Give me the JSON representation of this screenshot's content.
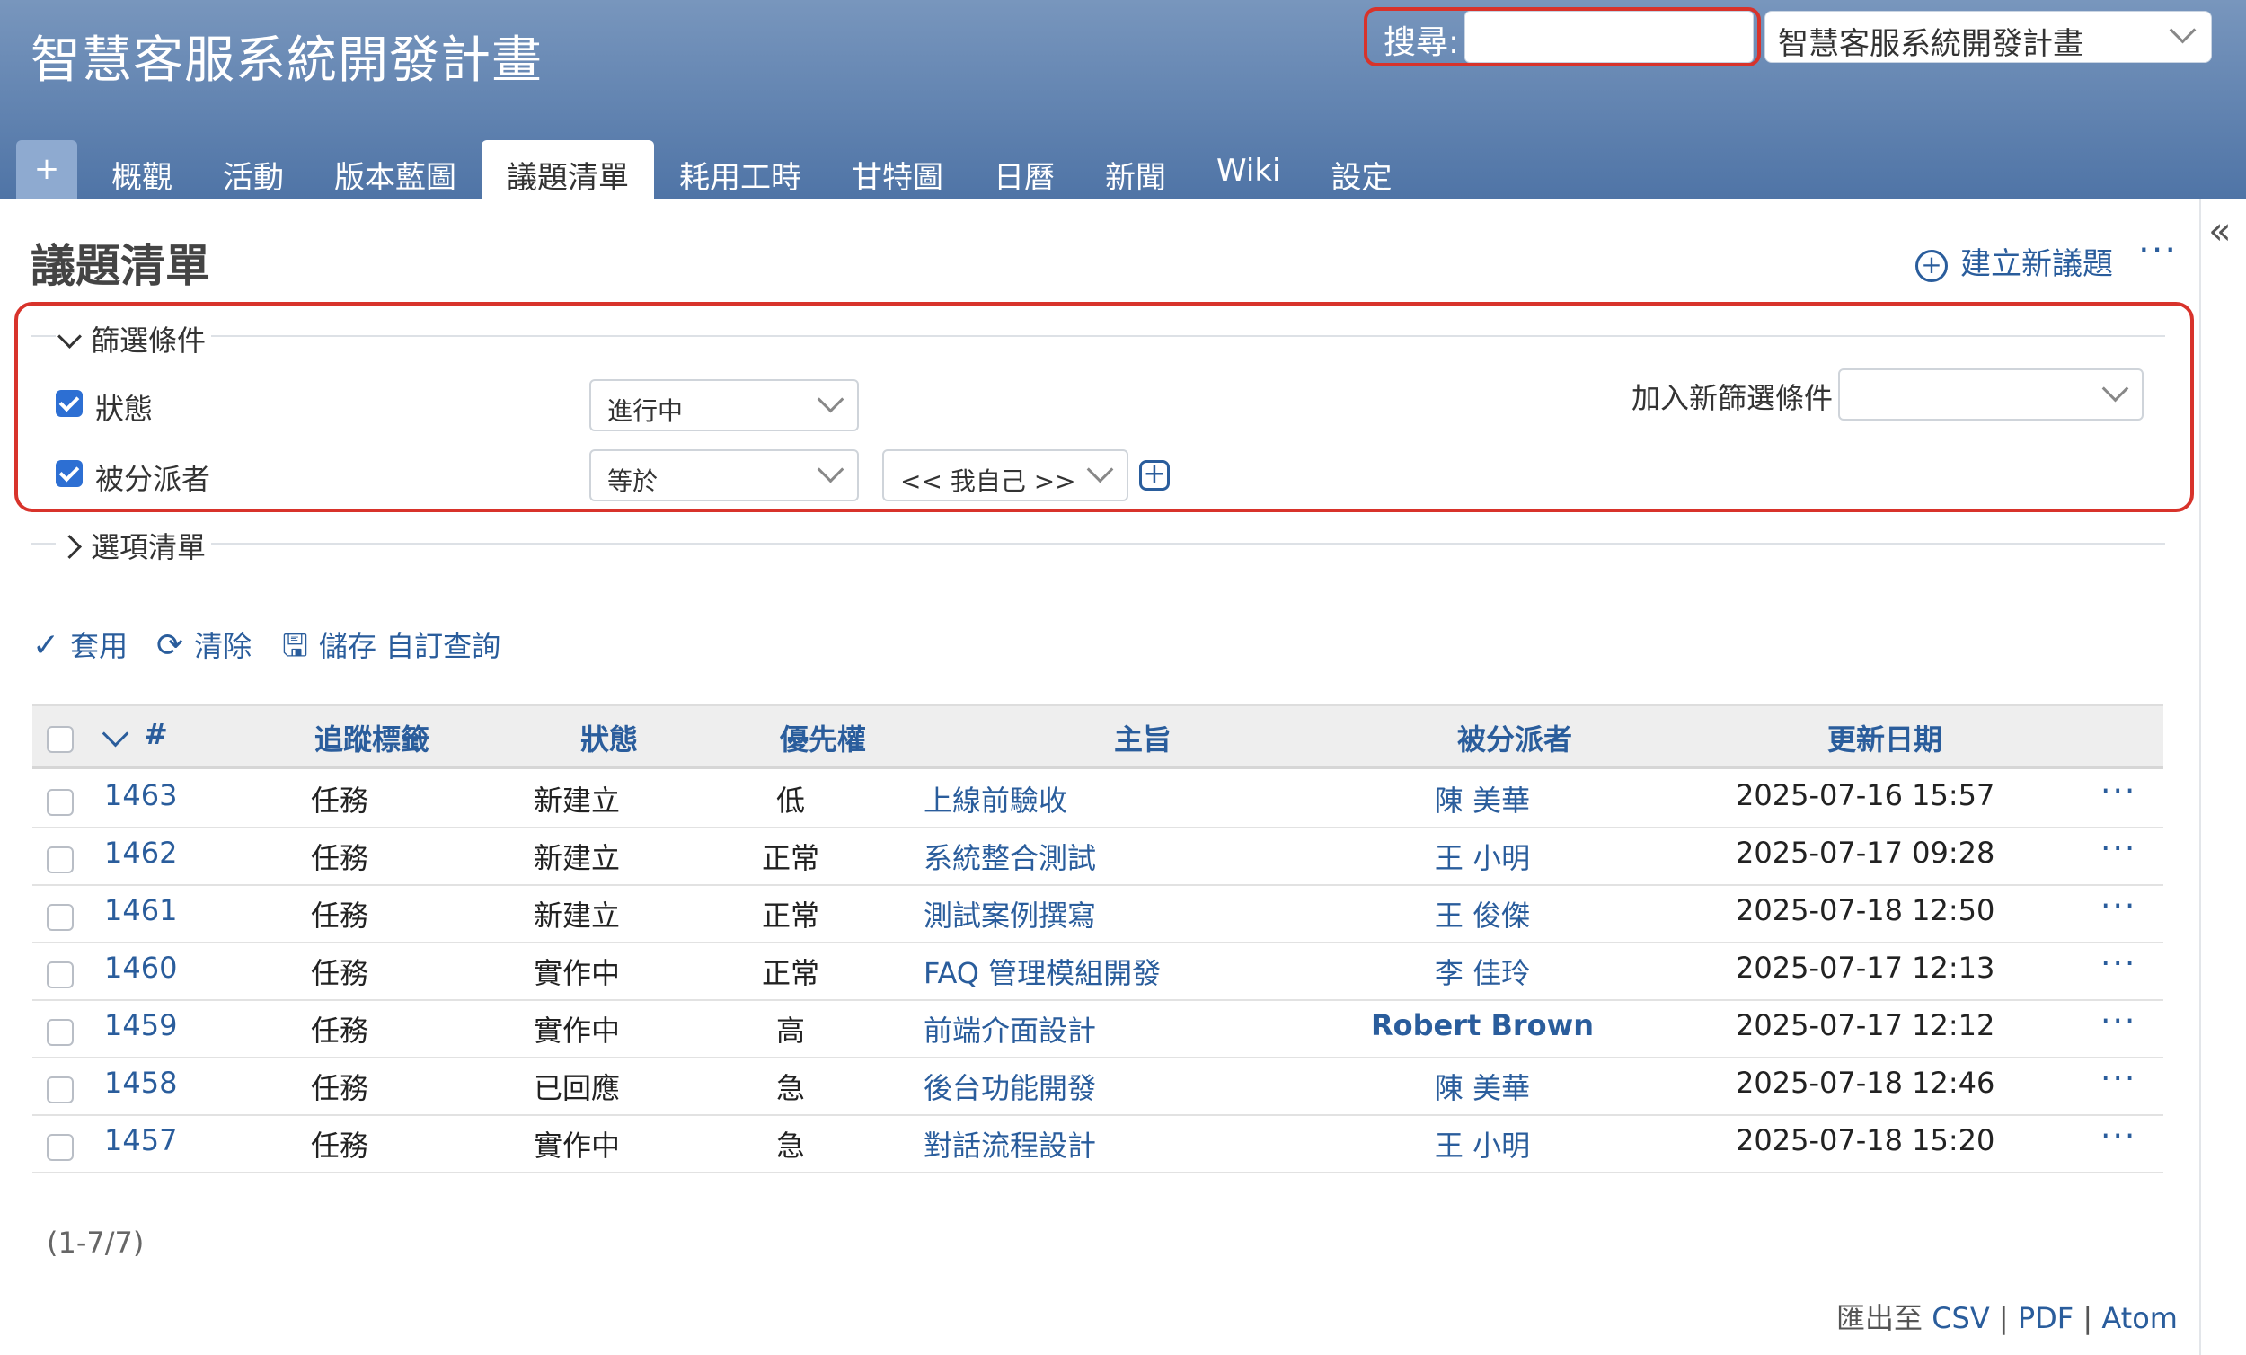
{
  "header": {
    "project_title": "智慧客服系統開發計畫",
    "search_label": "搜尋:",
    "search_value": "",
    "project_select": "智慧客服系統開發計畫"
  },
  "tabs": [
    {
      "label": "+"
    },
    {
      "label": "概觀"
    },
    {
      "label": "活動"
    },
    {
      "label": "版本藍圖"
    },
    {
      "label": "議題清單",
      "active": true
    },
    {
      "label": "耗用工時"
    },
    {
      "label": "甘特圖"
    },
    {
      "label": "日曆"
    },
    {
      "label": "新聞"
    },
    {
      "label": "Wiki"
    },
    {
      "label": "設定"
    }
  ],
  "page": {
    "title": "議題清單",
    "new_issue": "建立新議題",
    "more": "···"
  },
  "filters": {
    "legend": "篩選條件",
    "status_label": "狀態",
    "status_value": "進行中",
    "assignee_label": "被分派者",
    "assignee_op": "等於",
    "assignee_value": "<< 我自己 >>",
    "add_filter_label": "加入新篩選條件",
    "add_filter_value": ""
  },
  "options": {
    "legend": "選項清單"
  },
  "actions": {
    "apply": "套用",
    "clear": "清除",
    "save": "儲存 自訂查詢"
  },
  "table": {
    "headers": [
      "#",
      "追蹤標籤",
      "狀態",
      "優先權",
      "主旨",
      "被分派者",
      "更新日期"
    ],
    "rows": [
      {
        "id": "1463",
        "tracker": "任務",
        "status": "新建立",
        "priority": "低",
        "subject": "上線前驗收",
        "assignee": "陳 美華",
        "updated": "2025-07-16 15:57"
      },
      {
        "id": "1462",
        "tracker": "任務",
        "status": "新建立",
        "priority": "正常",
        "subject": "系統整合測試",
        "assignee": "王 小明",
        "updated": "2025-07-17 09:28"
      },
      {
        "id": "1461",
        "tracker": "任務",
        "status": "新建立",
        "priority": "正常",
        "subject": "測試案例撰寫",
        "assignee": "王 俊傑",
        "updated": "2025-07-18 12:50"
      },
      {
        "id": "1460",
        "tracker": "任務",
        "status": "實作中",
        "priority": "正常",
        "subject": "FAQ 管理模組開發",
        "assignee": "李 佳玲",
        "updated": "2025-07-17 12:13"
      },
      {
        "id": "1459",
        "tracker": "任務",
        "status": "實作中",
        "priority": "高",
        "subject": "前端介面設計",
        "assignee": "Robert Brown",
        "updated": "2025-07-17 12:12"
      },
      {
        "id": "1458",
        "tracker": "任務",
        "status": "已回應",
        "priority": "急",
        "subject": "後台功能開發",
        "assignee": "陳 美華",
        "updated": "2025-07-18 12:46"
      },
      {
        "id": "1457",
        "tracker": "任務",
        "status": "實作中",
        "priority": "急",
        "subject": "對話流程設計",
        "assignee": "王 小明",
        "updated": "2025-07-18 15:20"
      }
    ],
    "count": "(1-7/7)"
  },
  "export": {
    "label": "匯出至",
    "csv": "CSV",
    "pdf": "PDF",
    "atom": "Atom",
    "sep": "|"
  },
  "colors": {
    "header_top": "#7896bd",
    "header_bottom": "#4f74a6",
    "link": "#2a5d9c",
    "highlight": "#d8332b"
  }
}
